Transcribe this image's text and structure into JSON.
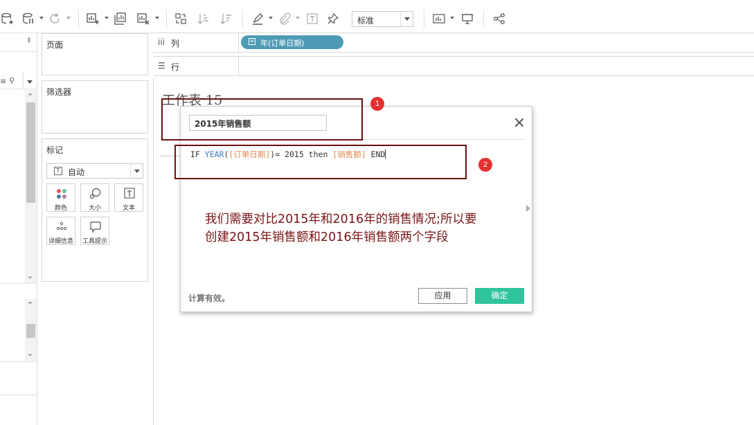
{
  "toolbar": {
    "view_size_select": {
      "value": "标准"
    }
  },
  "shelves": {
    "columns": {
      "label": "列",
      "pill": "年(订单日期)"
    },
    "rows": {
      "label": "行"
    }
  },
  "cards": {
    "pages_title": "页面",
    "filters_title": "筛选器",
    "marks": {
      "title": "标记",
      "type_select": "自动",
      "buttons": [
        {
          "label": "颜色",
          "icon": "color-icon"
        },
        {
          "label": "大小",
          "icon": "size-icon"
        },
        {
          "label": "文本",
          "icon": "text-icon"
        },
        {
          "label": "详细信息",
          "icon": "detail-icon"
        },
        {
          "label": "工具提示",
          "icon": "tooltip-icon"
        }
      ]
    }
  },
  "sheet": {
    "title": "工作表 15"
  },
  "calc_dialog": {
    "name": "2015年销售额",
    "formula": {
      "part1": "IF ",
      "fn": "YEAR",
      "part2": "(",
      "field1": "[订单日期]",
      "part3": ")= 2015 then ",
      "field2": "[销售额]",
      "part4": " END"
    },
    "status": "计算有效。",
    "apply_label": "应用",
    "ok_label": "确定"
  },
  "annotation": {
    "text_line1": "我们需要对比2015年和2016年的销售情况;所以要",
    "text_line2": "创建2015年销售额和2016年销售额两个字段",
    "badge1": "1",
    "badge2": "2",
    "color": "#6b1010"
  },
  "colors": {
    "pill": "#4e9bb5",
    "ok_button": "#2fc49b",
    "badge": "#e53030",
    "annotation_text": "#7a1416"
  }
}
